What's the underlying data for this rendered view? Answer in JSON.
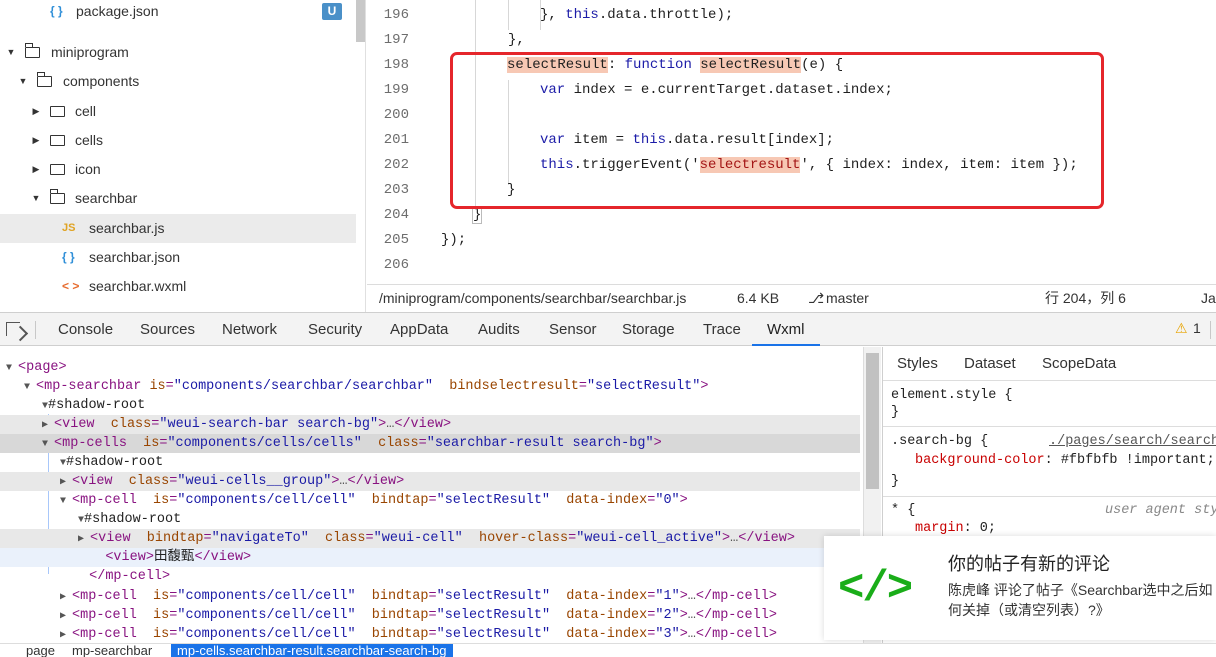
{
  "file_tree": {
    "items": [
      {
        "label": "package.json",
        "badge": "U",
        "icon": "json-icon"
      },
      {
        "label": "miniprogram",
        "icon": "folder-open-icon"
      },
      {
        "label": "components",
        "icon": "folder-open-icon"
      },
      {
        "label": "cell",
        "icon": "folder-icon"
      },
      {
        "label": "cells",
        "icon": "folder-icon"
      },
      {
        "label": "icon",
        "icon": "folder-icon"
      },
      {
        "label": "searchbar",
        "icon": "folder-open-icon"
      },
      {
        "label": "searchbar.js",
        "icon": "js-icon",
        "selected": true
      },
      {
        "label": "searchbar.json",
        "icon": "json-icon"
      },
      {
        "label": "searchbar.wxml",
        "icon": "wxml-icon"
      }
    ],
    "js_glyph": "JS",
    "json_glyph": "{ }",
    "wxml_glyph": "< >"
  },
  "editor": {
    "line_numbers": [
      "196",
      "197",
      "198",
      "199",
      "200",
      "201",
      "202",
      "203",
      "204",
      "205",
      "206"
    ],
    "code": {
      "l196a": "}, ",
      "l196b": "this",
      "l196c": ".data.throttle);",
      "l197": "},",
      "l198a": "selectResult",
      "l198b": ": ",
      "l198c": "function",
      "l198d": " ",
      "l198e": "selectResult",
      "l198f": "(e) {",
      "l199a": "var",
      "l199b": " index = e.currentTarget.dataset.index;",
      "l201a": "var",
      "l201b": " item = ",
      "l201c": "this",
      "l201d": ".data.result[index];",
      "l202a": "this",
      "l202b": ".triggerEvent('",
      "l202c": "selectresult",
      "l202d": "', { index: index, item: item });",
      "l203": "}",
      "l204": "}",
      "l205": "});"
    }
  },
  "status_bar": {
    "path": "/miniprogram/components/searchbar/searchbar.js",
    "size": "6.4 KB",
    "branch": "master",
    "position": "行 204，列 6",
    "extra": "Ja"
  },
  "devtools_tabs": [
    "Console",
    "Sources",
    "Network",
    "Security",
    "AppData",
    "Audits",
    "Sensor",
    "Storage",
    "Trace",
    "Wxml"
  ],
  "active_tab": "Wxml",
  "warnings": {
    "count": "1",
    "glyph": "⚠"
  },
  "dom": {
    "page_open": "<page>",
    "mp_searchbar_tag": "<mp-searchbar",
    "mp_searchbar_is": "is",
    "mp_searchbar_is_val": "\"components/searchbar/searchbar\"",
    "mp_searchbar_bind": "bindselectresult",
    "mp_searchbar_bind_val": "\"selectResult\"",
    "shadow_root": "#shadow-root",
    "view_tag": "<view",
    "class_attr": "class",
    "view1_class": "\"weui-search-bar search-bg\"",
    "close_view": "</view>",
    "ellipsis": "…",
    "gt": ">",
    "mp_cells_tag": "<mp-cells",
    "is_attr": "is",
    "mp_cells_is": "\"components/cells/cells\"",
    "mp_cells_class": "\"searchbar-result search-bg\"",
    "cells_group_class": "\"weui-cells__group\"",
    "mp_cell_tag": "<mp-cell",
    "mp_cell_is": "\"components/cell/cell\"",
    "bindtap_attr": "bindtap",
    "bindtap_val": "\"selectResult\"",
    "data_index_attr": "data-index",
    "idx0": "\"0\"",
    "idx1": "\"1\"",
    "idx2": "\"2\"",
    "idx3": "\"3\"",
    "navigate_bindtap": "\"navigateTo\"",
    "weui_cell_class": "\"weui-cell\"",
    "hover_class_attr": "hover-class",
    "hover_class_val": "\"weui-cell_active\"",
    "view_text_open": "<view>",
    "view_text": "田馥甄",
    "close_mp_cell": "</mp-cell>",
    "eq": "="
  },
  "styles_panel": {
    "tabs": [
      "Styles",
      "Dataset",
      "ScopeData"
    ],
    "element_style": "element.style {",
    "close_brace": "}",
    "rule1_selector": ".search-bg {",
    "rule1_source": "./pages/search/search",
    "rule1_prop": "background-color",
    "rule1_value": ": #fbfbfb !important;",
    "rule2_selector": "* {",
    "rule2_source": "user agent sty",
    "rule2_prop": "margin",
    "rule2_value": ": 0;"
  },
  "notification": {
    "icon_glyph": "</>",
    "title": "你的帖子有新的评论",
    "body": "陈虎峰 评论了帖子《Searchbar选中之后如何关掉（或清空列表）?》"
  },
  "breadcrumb": {
    "items": [
      "page",
      "mp-searchbar"
    ],
    "current": "mp-cells.searchbar-result.searchbar-search-bg"
  }
}
